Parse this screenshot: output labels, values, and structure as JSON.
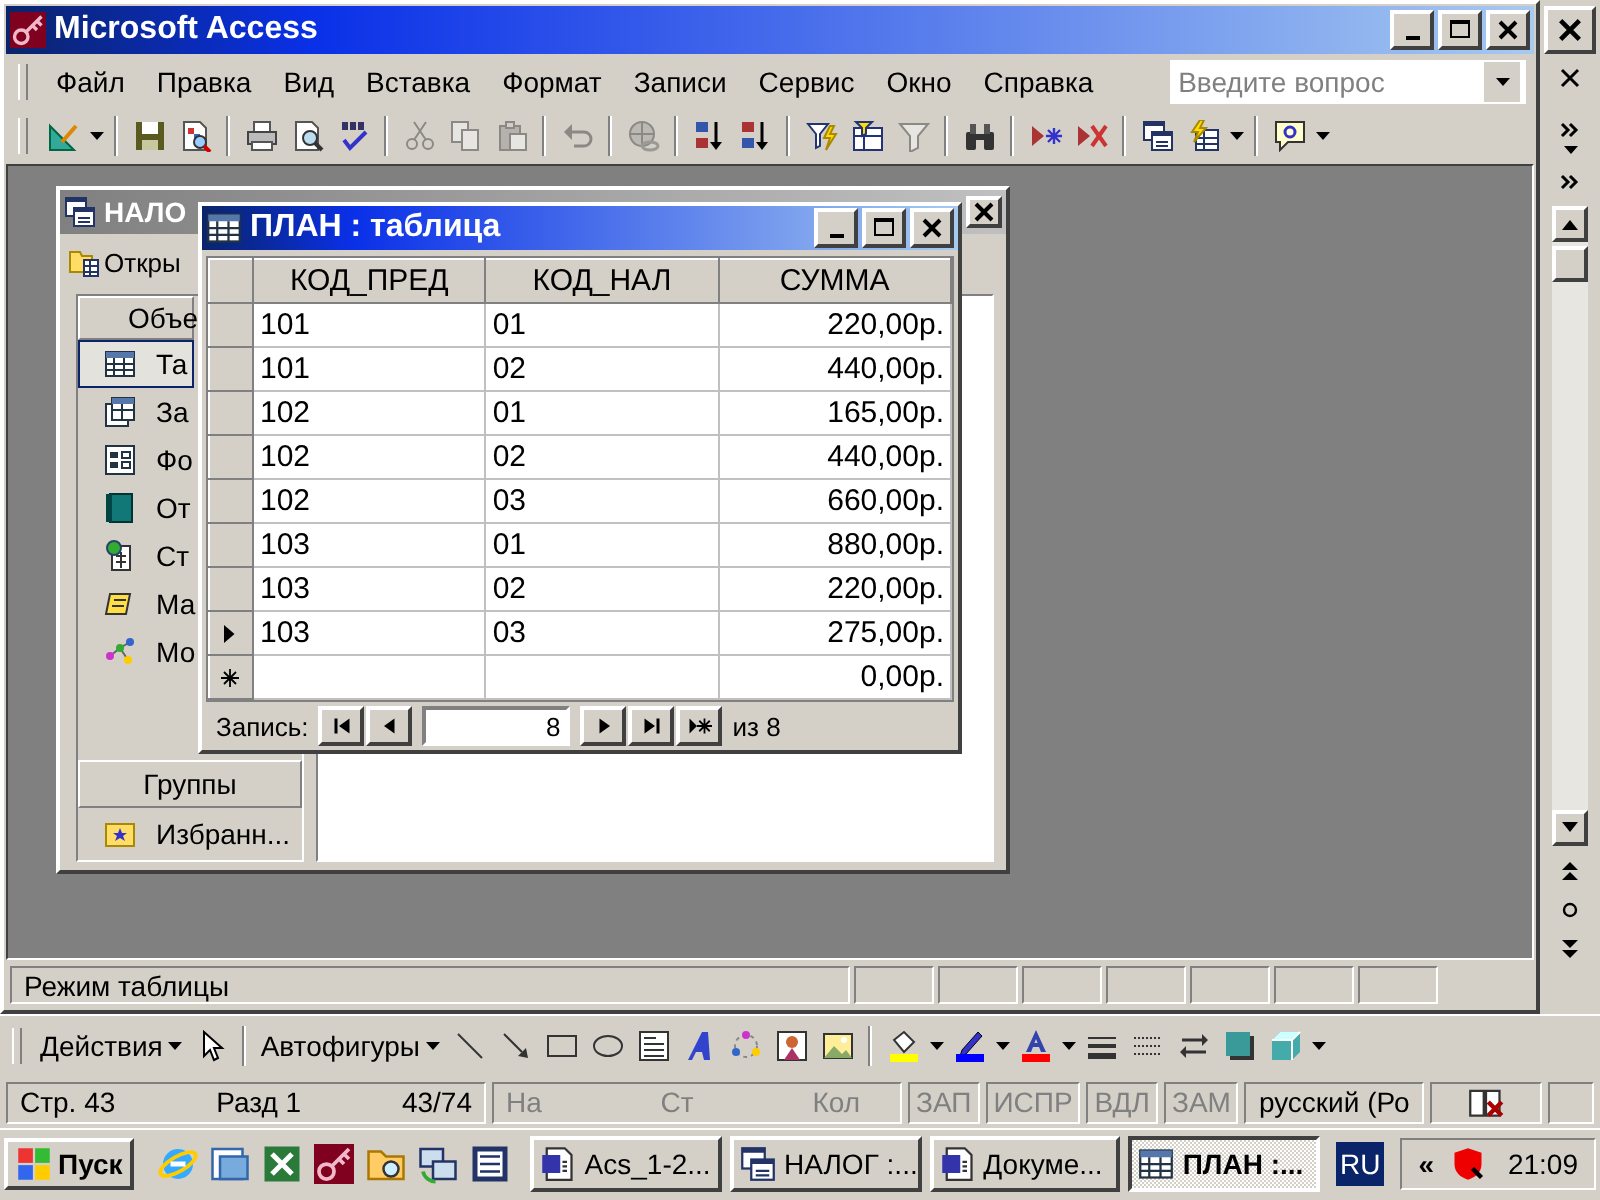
{
  "window": {
    "title": "Microsoft Access"
  },
  "menu": [
    "Файл",
    "Правка",
    "Вид",
    "Вставка",
    "Формат",
    "Записи",
    "Сервис",
    "Окно",
    "Справка"
  ],
  "question_box": {
    "placeholder": "Введите вопрос"
  },
  "toolbar": {
    "groups": [
      [
        {
          "kind": "design",
          "disabled": false
        },
        {
          "kind": "dropdown",
          "disabled": false
        }
      ],
      [
        {
          "kind": "save",
          "disabled": false
        },
        {
          "kind": "filesearch",
          "disabled": false
        }
      ],
      [
        {
          "kind": "print",
          "disabled": false
        },
        {
          "kind": "preview",
          "disabled": false
        },
        {
          "kind": "spelling",
          "disabled": false
        }
      ],
      [
        {
          "kind": "cut",
          "disabled": true
        },
        {
          "kind": "copy",
          "disabled": true
        },
        {
          "kind": "paste",
          "disabled": true
        }
      ],
      [
        {
          "kind": "undo",
          "disabled": true
        }
      ],
      [
        {
          "kind": "hyperlink",
          "disabled": true
        }
      ],
      [
        {
          "kind": "sortup",
          "disabled": false
        },
        {
          "kind": "sortdown",
          "disabled": false
        }
      ],
      [
        {
          "kind": "filterselection",
          "disabled": false
        },
        {
          "kind": "filterform",
          "disabled": false
        },
        {
          "kind": "applyfilter",
          "disabled": true
        }
      ],
      [
        {
          "kind": "find",
          "disabled": false
        }
      ],
      [
        {
          "kind": "newrecord",
          "disabled": false
        },
        {
          "kind": "deleterecord",
          "disabled": false
        }
      ],
      [
        {
          "kind": "dbwindow",
          "disabled": false
        },
        {
          "kind": "newobject",
          "disabled": false
        },
        {
          "kind": "dropdown",
          "disabled": false
        }
      ],
      [
        {
          "kind": "help",
          "disabled": false
        },
        {
          "kind": "dropdown",
          "disabled": false
        }
      ]
    ]
  },
  "database_window": {
    "title": "НАЛО",
    "open_button": "Откры",
    "objects_header": "Объе",
    "objects": [
      {
        "label": "Та",
        "kind": "table",
        "selected": true
      },
      {
        "label": "За",
        "kind": "query",
        "selected": false
      },
      {
        "label": "Фо",
        "kind": "form",
        "selected": false
      },
      {
        "label": "От",
        "kind": "report",
        "selected": false
      },
      {
        "label": "Ст",
        "kind": "page",
        "selected": false
      },
      {
        "label": "Ма",
        "kind": "macro",
        "selected": false
      },
      {
        "label": "Мо",
        "kind": "module",
        "selected": false
      }
    ],
    "groups_header": "Группы",
    "groups": [
      {
        "label": "Избранн..."
      }
    ]
  },
  "table_window": {
    "title": "ПЛАН : таблица",
    "columns": [
      "КОД_ПРЕД",
      "КОД_НАЛ",
      "СУММА"
    ],
    "rows": [
      {
        "kind": "record",
        "code": "101",
        "tax_code": "01",
        "amount": "220,00р.",
        "current": false
      },
      {
        "kind": "record",
        "code": "101",
        "tax_code": "02",
        "amount": "440,00р.",
        "current": false
      },
      {
        "kind": "record",
        "code": "102",
        "tax_code": "01",
        "amount": "165,00р.",
        "current": false
      },
      {
        "kind": "record",
        "code": "102",
        "tax_code": "02",
        "amount": "440,00р.",
        "current": false
      },
      {
        "kind": "record",
        "code": "102",
        "tax_code": "03",
        "amount": "660,00р.",
        "current": false
      },
      {
        "kind": "record",
        "code": "103",
        "tax_code": "01",
        "amount": "880,00р.",
        "current": false
      },
      {
        "kind": "record",
        "code": "103",
        "tax_code": "02",
        "amount": "220,00р.",
        "current": false
      },
      {
        "kind": "record",
        "code": "103",
        "tax_code": "03",
        "amount": "275,00р.",
        "current": true
      },
      {
        "kind": "new",
        "amount": "0,00р.",
        "current": false
      }
    ],
    "navigator": {
      "label": "Запись:",
      "value": "8",
      "total": "из 8"
    }
  },
  "status_bar": "Режим таблицы",
  "drawing_toolbar": {
    "actions": "Действия",
    "autoshapes": "Автофигуры"
  },
  "word_status": [
    {
      "items": [
        "Стр. 43",
        "Разд 1",
        "43/74"
      ],
      "disabled": false
    },
    {
      "items": [
        "На",
        "Ст",
        "Кол"
      ],
      "disabled": true
    },
    {
      "items": [
        "ЗАП"
      ],
      "disabled": true
    },
    {
      "items": [
        "ИСПР"
      ],
      "disabled": true
    },
    {
      "items": [
        "ВДЛ"
      ],
      "disabled": true
    },
    {
      "items": [
        "ЗАМ"
      ],
      "disabled": true
    },
    {
      "items": [
        "русский (Ро"
      ],
      "disabled": false
    }
  ],
  "taskbar": {
    "start": "Пуск",
    "tasks": [
      {
        "label": "Acs_1-2...",
        "kind": "document",
        "selected": false
      },
      {
        "label": "НАЛОГ :...",
        "kind": "database",
        "selected": false
      },
      {
        "label": "Докуме...",
        "kind": "document",
        "selected": false
      },
      {
        "label": "ПЛАН :...",
        "kind": "table",
        "selected": true
      }
    ],
    "language": "RU",
    "tray_expand": "«",
    "clock": "21:09"
  }
}
